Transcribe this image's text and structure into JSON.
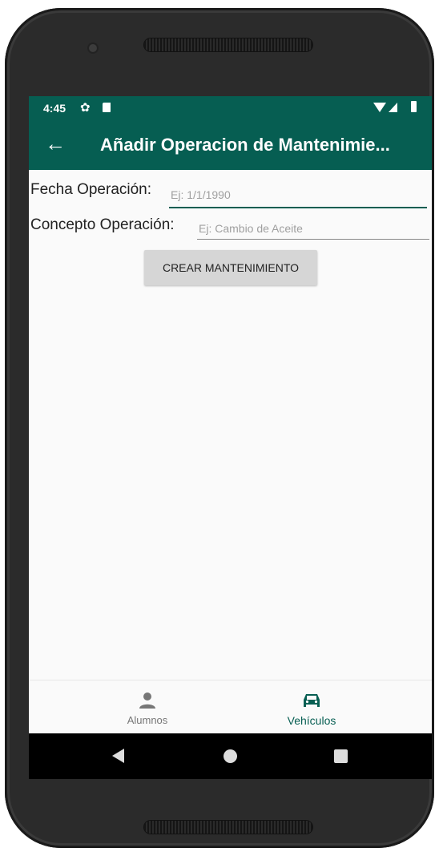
{
  "status_bar": {
    "time": "4:45"
  },
  "app_bar": {
    "title": "Añadir Operacion de Mantenimie..."
  },
  "form": {
    "fecha_label": "Fecha Operación:",
    "fecha_placeholder": "Ej: 1/1/1990",
    "concepto_label": "Concepto Operación:",
    "concepto_placeholder": "Ej: Cambio de Aceite",
    "submit_label": "CREAR MANTENIMIENTO"
  },
  "bottom_nav": {
    "items": [
      {
        "label": "Alumnos",
        "icon": "person-icon",
        "selected": false
      },
      {
        "label": "Vehículos",
        "icon": "car-icon",
        "selected": true
      }
    ]
  },
  "colors": {
    "primary": "#065e52",
    "background": "#fafafa",
    "button": "#d6d6d6"
  }
}
